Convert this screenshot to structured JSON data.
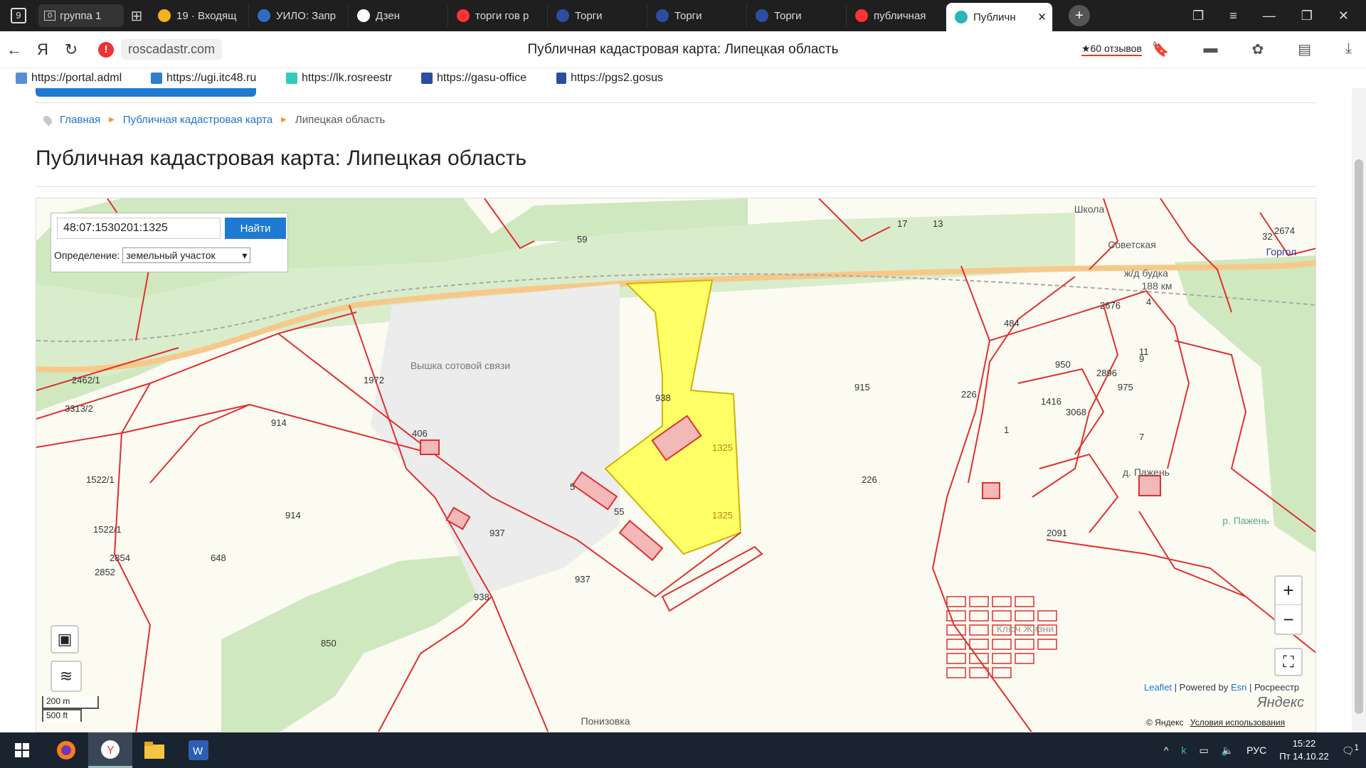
{
  "browser": {
    "tab_counter": "9",
    "group_tab": {
      "count": "0",
      "label": "группа 1"
    },
    "tabs": [
      {
        "label": "19 · Входящ",
        "color": "#f2b21a"
      },
      {
        "label": "УИЛО: Запр",
        "color": "#2e6bc5"
      },
      {
        "label": "Дзен",
        "color": "#ffffff"
      },
      {
        "label": "торги гов р",
        "color": "#f33"
      },
      {
        "label": "Торги",
        "color": "#2b4ea3"
      },
      {
        "label": "Торги",
        "color": "#2b4ea3"
      },
      {
        "label": "Торги",
        "color": "#2b4ea3"
      },
      {
        "label": "публичная",
        "color": "#f33"
      },
      {
        "label": "Публичн",
        "color": "#2bb5b5",
        "active": true
      }
    ],
    "url": "roscadastr.com",
    "page_title": "Публичная кадастровая карта: Липецкая область",
    "reviews": "★60 отзывов",
    "bookmarks": [
      "https://portal.adml",
      "https://ugi.itc48.ru",
      "https://lk.rosreestr",
      "https://gasu-office",
      "https://pgs2.gosus"
    ]
  },
  "page": {
    "breadcrumbs": [
      "Главная",
      "Публичная кадастровая карта",
      "Липецкая область"
    ],
    "heading": "Публичная кадастровая карта: Липецкая область"
  },
  "map": {
    "search": {
      "value": "48:07:1530201:1325",
      "button": "Найти"
    },
    "definition": {
      "label": "Определение:",
      "selected": "земельный участок"
    },
    "highlight_color": "#ffff66",
    "parcel_labels": [
      "1325",
      "1325",
      "915",
      "914",
      "914",
      "1972",
      "2462/1",
      "3313/2",
      "648",
      "937",
      "937",
      "938",
      "938",
      "5",
      "55",
      "406",
      "59",
      "484",
      "1",
      "2091",
      "226",
      "226",
      "2676",
      "950",
      "1416",
      "3068",
      "2896",
      "975",
      "4",
      "7",
      "9",
      "11",
      "32",
      "2852",
      "2854",
      "1522/1",
      "1522/1",
      "850",
      "17",
      "13",
      "2674"
    ],
    "place_labels": [
      "Вышка сотовой связи",
      "ж/д будка",
      "188 км",
      "д. Пажень",
      "Ключ Жизни",
      "р. Пажень",
      "Понизовка",
      "Советская",
      "Школа",
      "Горгол"
    ],
    "scale": [
      "200 m",
      "500 ft"
    ],
    "attribution": {
      "leaflet": "Leaflet",
      "powered": "| Powered by",
      "esri": "Esri",
      "rosreestr": "| Росреестр"
    },
    "yandex_logo": "Яндекс",
    "yandex_copyright": "© Яндекс",
    "yandex_terms": "Условия использования",
    "zoom_in": "+",
    "zoom_out": "−"
  },
  "taskbar": {
    "lang": "РУС",
    "time": "15:22",
    "date": "Пт 14.10.22",
    "notif": "1"
  }
}
